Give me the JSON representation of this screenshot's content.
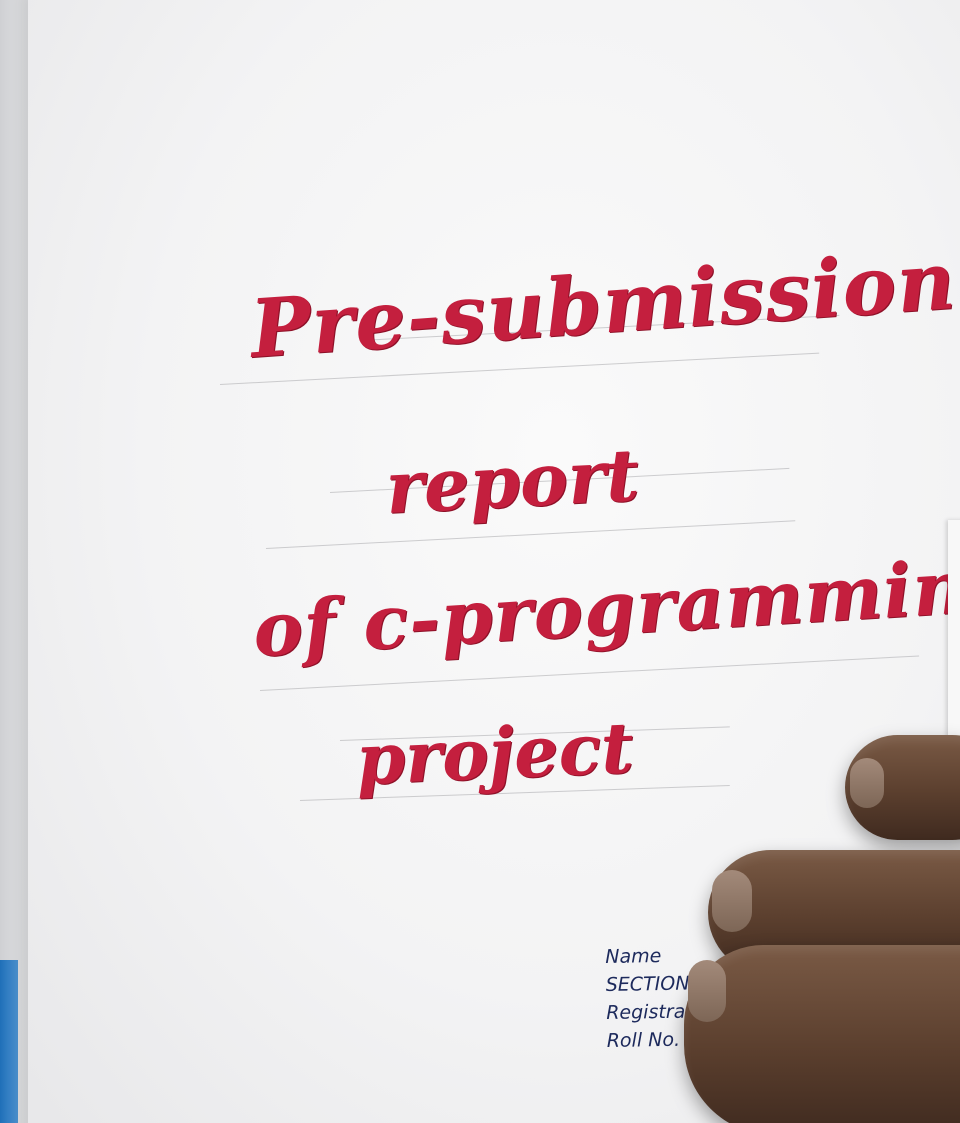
{
  "title_lines": [
    "Pre-submission",
    "report",
    "of c-programming",
    "project"
  ],
  "fields": {
    "name": "Name",
    "section": "SECTION",
    "registration": "Registration",
    "roll_no": "Roll No."
  },
  "colors": {
    "ink_red": "#c41f3e",
    "ink_blue": "#1d2a5c",
    "paper": "#f3f3f4",
    "skin": "#5b3f2e"
  }
}
